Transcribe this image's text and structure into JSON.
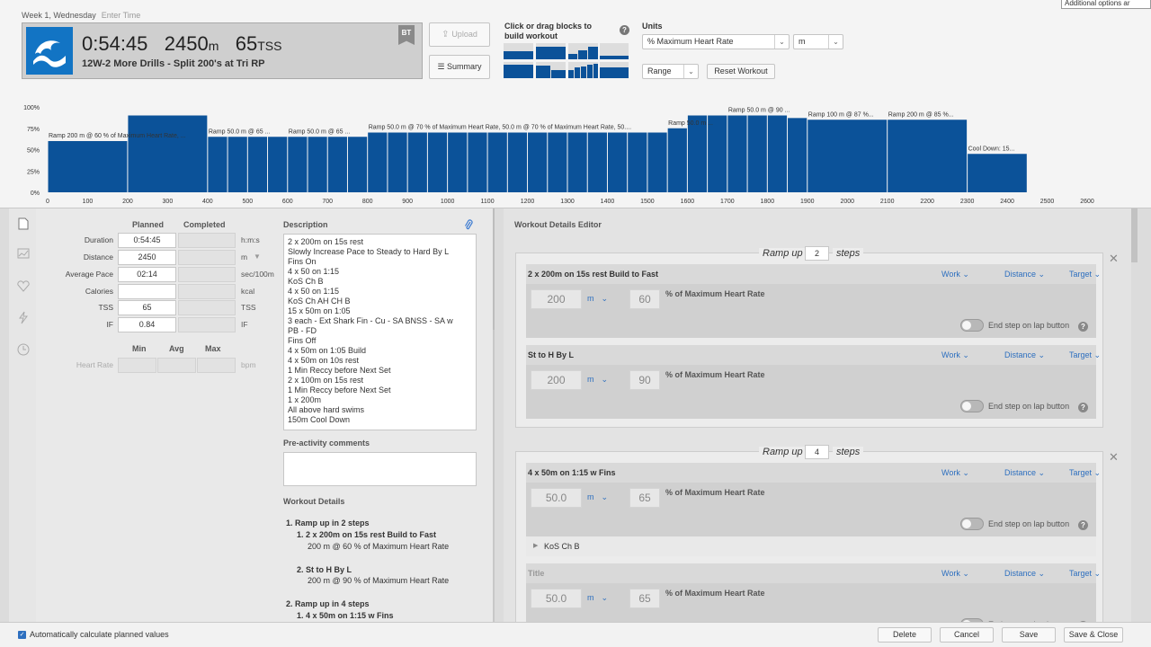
{
  "tooltip": "Additional options ar",
  "header": {
    "week": "Week 1, Wednesday",
    "enter_time": "Enter Time",
    "duration": "0:54:45",
    "distance": "2450",
    "distance_unit": "m",
    "tss": "65",
    "tss_unit": "TSS",
    "title": "12W-2 More Drills - Split 200's at Tri RP",
    "badge": "BT"
  },
  "toolbar": {
    "upload": "Upload",
    "summary": "Summary",
    "blocks_title": "Click or drag blocks to build workout",
    "units_label": "Units",
    "intensity_select": "% Maximum Heart Rate",
    "distance_select": "m",
    "range_select": "Range",
    "reset": "Reset Workout"
  },
  "chart_data": {
    "type": "bar",
    "title": "",
    "xlabel": "",
    "ylabel": "",
    "y_ticks": [
      "100%",
      "75%",
      "50%",
      "25%",
      "0%"
    ],
    "x_ticks": [
      "0",
      "100",
      "200",
      "300",
      "400",
      "500",
      "600",
      "700",
      "800",
      "900",
      "1000",
      "1100",
      "1200",
      "1300",
      "1400",
      "1500",
      "1600",
      "1700",
      "1800",
      "1900",
      "2000",
      "2100",
      "2200",
      "2300",
      "2400",
      "2500",
      "2600"
    ],
    "xlim": [
      0,
      2600
    ],
    "ylim": [
      0,
      100
    ],
    "bars": [
      [
        0,
        200,
        60
      ],
      [
        200,
        400,
        90
      ],
      [
        400,
        450,
        65
      ],
      [
        450,
        500,
        65
      ],
      [
        500,
        550,
        65
      ],
      [
        550,
        600,
        65
      ],
      [
        600,
        650,
        65
      ],
      [
        650,
        700,
        65
      ],
      [
        700,
        750,
        65
      ],
      [
        750,
        800,
        65
      ],
      [
        800,
        850,
        70
      ],
      [
        850,
        900,
        70
      ],
      [
        900,
        950,
        70
      ],
      [
        950,
        1000,
        70
      ],
      [
        1000,
        1050,
        70
      ],
      [
        1050,
        1100,
        70
      ],
      [
        1100,
        1150,
        70
      ],
      [
        1150,
        1200,
        70
      ],
      [
        1200,
        1250,
        70
      ],
      [
        1250,
        1300,
        70
      ],
      [
        1300,
        1350,
        70
      ],
      [
        1350,
        1400,
        70
      ],
      [
        1400,
        1450,
        70
      ],
      [
        1450,
        1500,
        70
      ],
      [
        1500,
        1550,
        70
      ],
      [
        1550,
        1600,
        75
      ],
      [
        1600,
        1650,
        90
      ],
      [
        1650,
        1700,
        90
      ],
      [
        1700,
        1750,
        90
      ],
      [
        1750,
        1800,
        90
      ],
      [
        1800,
        1850,
        90
      ],
      [
        1850,
        1900,
        87
      ],
      [
        1900,
        2100,
        85
      ],
      [
        2100,
        2300,
        85
      ],
      [
        2300,
        2450,
        45
      ]
    ],
    "annotations": [
      {
        "x": 0,
        "text": "Ramp 200 m @ 60 % of Maximum Heart Rate, ..."
      },
      {
        "x": 400,
        "text": "Ramp 50.0 m @ 65 ..."
      },
      {
        "x": 600,
        "text": "Ramp 50.0 m @ 65 ..."
      },
      {
        "x": 800,
        "text": "Ramp 50.0 m @ 70 % of Maximum Heart Rate, 50.0 m @ 70 % of Maximum Heart Rate, 50...."
      },
      {
        "x": 1550,
        "text": "Ramp 50.0 m ..."
      },
      {
        "x": 1700,
        "text": "Ramp 50.0 m @ 90 ..."
      },
      {
        "x": 1900,
        "text": "Ramp 100 m @ 87 %..."
      },
      {
        "x": 2100,
        "text": "Ramp 200 m @ 85 %..."
      },
      {
        "x": 2300,
        "text": "Cool Down: 15..."
      }
    ]
  },
  "colors": {
    "bar": "#0b5299",
    "accent": "#2d6fbf",
    "swim_icon": "#1274c4"
  },
  "summary": {
    "planned": "Planned",
    "completed": "Completed",
    "rows": [
      {
        "label": "Duration",
        "value": "0:54:45",
        "unit": "h:m:s"
      },
      {
        "label": "Distance",
        "value": "2450",
        "unit": "m"
      },
      {
        "label": "Average Pace",
        "value": "02:14",
        "unit": "sec/100m"
      },
      {
        "label": "Calories",
        "value": "",
        "unit": "kcal"
      },
      {
        "label": "TSS",
        "value": "65",
        "unit": "TSS"
      },
      {
        "label": "IF",
        "value": "0.84",
        "unit": "IF"
      }
    ],
    "min": "Min",
    "avg": "Avg",
    "max": "Max",
    "hr_label": "Heart Rate",
    "hr_unit": "bpm"
  },
  "description": {
    "label": "Description",
    "lines": [
      "2 x 200m on 15s rest",
      "Slowly Increase Pace to Steady to Hard By L",
      "Fins On",
      "4 x 50 on 1:15",
      "KoS Ch B",
      "4 x 50 on 1:15",
      "KoS Ch AH CH B",
      "15 x 50m on 1:05",
      "3 each - Ext Shark Fin - Cu - SA BNSS - SA w",
      "PB - FD",
      "Fins Off",
      "4 x 50m on 1:05 Build",
      "4 x 50m on 10s rest",
      "1 Min Reccy before Next Set",
      "2 x 100m on 15s rest",
      "1 Min Reccy before Next Set",
      "1 x 200m",
      "All above hard swims",
      "150m Cool Down"
    ]
  },
  "pre_comments": "Pre-activity comments",
  "workout_details": {
    "label": "Workout Details",
    "l1": "1.  Ramp up in 2 steps",
    "l2": "1.  2 x 200m on 15s rest Build to Fast",
    "l3": "200 m @ 60 % of Maximum Heart Rate",
    "l4": "2.  St to H By L",
    "l5": "200 m @ 90 % of Maximum Heart Rate",
    "l6": "2.  Ramp up in 4 steps",
    "l7": "1.  4 x 50m on 1:15 w Fins"
  },
  "editor": {
    "title": "Workout Details Editor",
    "ramp_label": "Ramp up",
    "steps_label": "steps",
    "work": "Work",
    "distance": "Distance",
    "target": "Target",
    "pct_label": "% of Maximum Heart Rate",
    "end_step": "End step on lap button",
    "g1": {
      "steps": "2",
      "s1": {
        "title": "2 x 200m on 15s rest Build to Fast",
        "dist": "200",
        "unit": "m",
        "pct": "60"
      },
      "s2": {
        "title": "St to H By L",
        "dist": "200",
        "unit": "m",
        "pct": "90"
      }
    },
    "g2": {
      "steps": "4",
      "s1": {
        "title": "4 x 50m on 1:15 w Fins",
        "dist": "50.0",
        "unit": "m",
        "pct": "65",
        "sub": "KoS Ch B"
      },
      "s2": {
        "title": "Title",
        "dist": "50.0",
        "unit": "m",
        "pct": "65"
      }
    }
  },
  "footer": {
    "auto_calc": "Automatically calculate planned values",
    "delete": "Delete",
    "cancel": "Cancel",
    "save": "Save",
    "save_close": "Save & Close"
  }
}
